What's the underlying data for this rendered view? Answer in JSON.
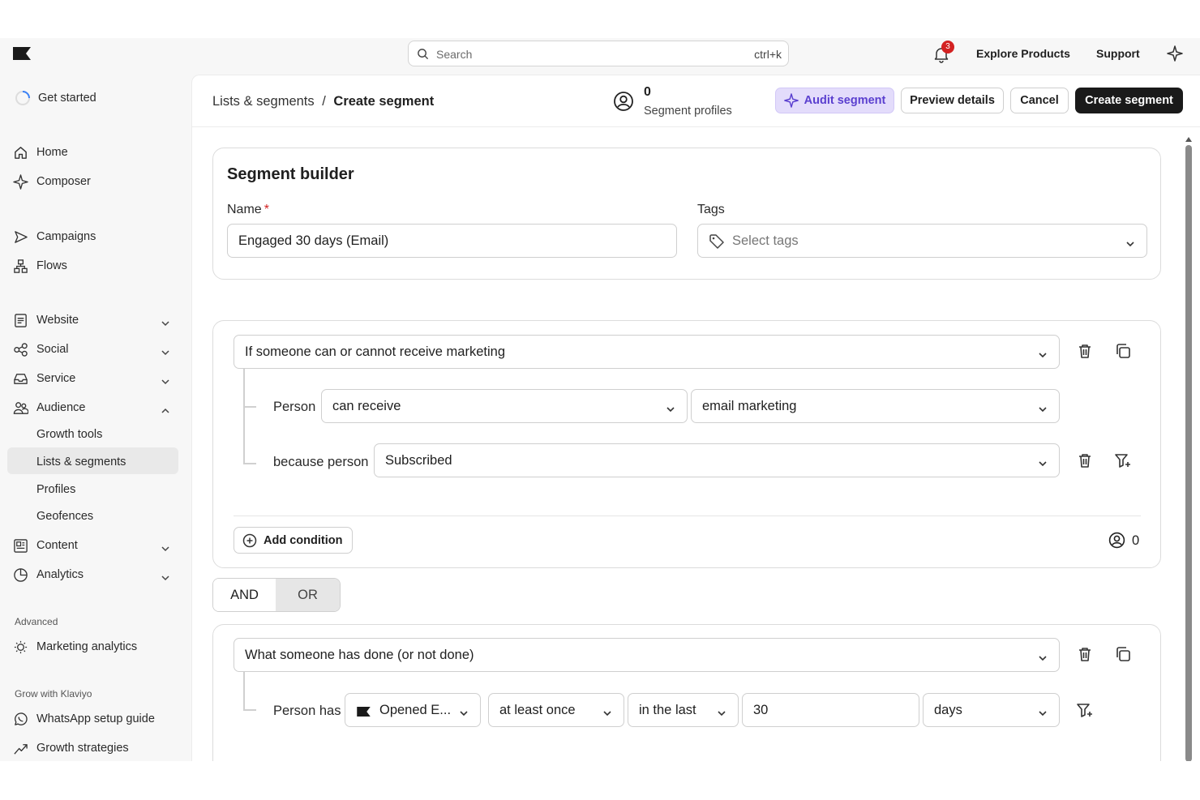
{
  "topbar": {
    "search_placeholder": "Search",
    "search_shortcut": "ctrl+k",
    "notification_count": "3",
    "explore_products": "Explore Products",
    "support": "Support"
  },
  "sidebar": {
    "get_started": "Get started",
    "home": "Home",
    "composer": "Composer",
    "campaigns": "Campaigns",
    "flows": "Flows",
    "website": "Website",
    "social": "Social",
    "service": "Service",
    "audience": "Audience",
    "audience_sub": [
      "Growth tools",
      "Lists & segments",
      "Profiles",
      "Geofences"
    ],
    "content": "Content",
    "analytics": "Analytics",
    "advanced_label": "Advanced",
    "marketing_analytics": "Marketing analytics",
    "grow_label": "Grow with Klaviyo",
    "whatsapp": "WhatsApp setup guide",
    "growth_strategies": "Growth strategies"
  },
  "header": {
    "breadcrumb_parent": "Lists & segments",
    "breadcrumb_sep": "/",
    "breadcrumb_current": "Create segment",
    "profiles_count": "0",
    "profiles_label": "Segment profiles",
    "audit_btn": "Audit segment",
    "preview_btn": "Preview details",
    "cancel_btn": "Cancel",
    "create_btn": "Create segment"
  },
  "builder": {
    "title": "Segment builder",
    "name_label": "Name",
    "required_mark": "*",
    "name_value": "Engaged 30 days (Email)",
    "tags_label": "Tags",
    "tags_placeholder": "Select tags"
  },
  "group1": {
    "condition": "If someone can or cannot receive marketing",
    "person_label": "Person",
    "can_receive": "can receive",
    "channel": "email marketing",
    "because_label": "because person",
    "reason": "Subscribed",
    "add_condition": "Add condition",
    "count": "0"
  },
  "logic": {
    "and": "AND",
    "or": "OR"
  },
  "group2": {
    "condition": "What someone has done (or not done)",
    "person_has": "Person has",
    "metric": "Opened E...",
    "frequency": "at least once",
    "timeframe": "in the last",
    "amount": "30",
    "unit": "days"
  }
}
